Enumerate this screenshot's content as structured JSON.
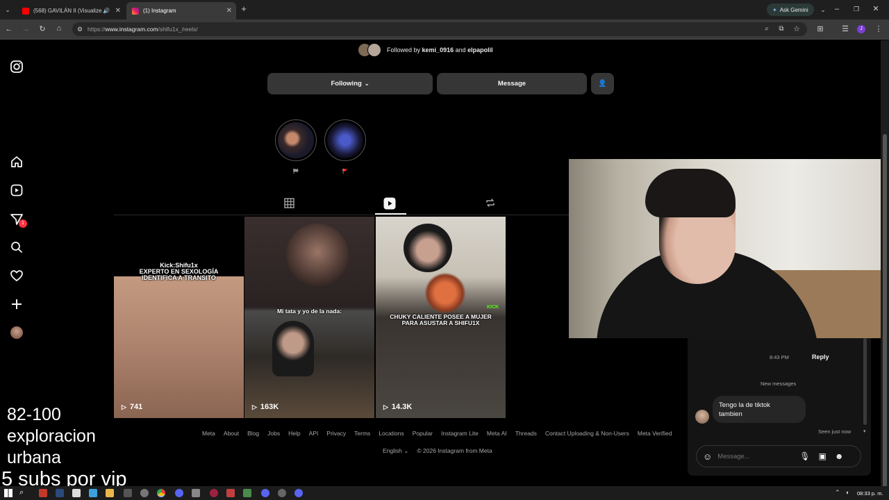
{
  "browser": {
    "tabs": [
      {
        "label": "(568) GAVILÁN II (Visualize",
        "favicon": "youtube"
      },
      {
        "label": "(1) Instagram",
        "favicon": "instagram"
      }
    ],
    "new_tab": "+",
    "url_scheme": "https://",
    "url_host": "www.instagram.com",
    "url_path": "/shifu1x_/reels/",
    "ask_gemini": "Ask Gemini",
    "profile_initial": "J",
    "window_controls": [
      "–",
      "❐",
      "✕"
    ]
  },
  "profile": {
    "followed_by_prefix": "Followed by",
    "followed_by_1": "kemi_0916",
    "followed_by_and": "and",
    "followed_by_2": "elpapolil",
    "following_label": "Following",
    "message_label": "Message",
    "highlights": [
      {
        "label": "🏁"
      },
      {
        "label": "🚩"
      }
    ]
  },
  "nav": {
    "notifications_badge": "1"
  },
  "reels": [
    {
      "views": "741",
      "caption": "Kick:Shifu1x\nEXPERTO EN SEXOLOGÍA\nIDENTIFICA A TRANSITO"
    },
    {
      "views": "163K",
      "caption": "Mi tata y yo de la nada:"
    },
    {
      "views": "14.3K",
      "caption": "CHUKY CALIENTE POSEE A MUJER\nPARA ASUSTAR A SHIFU1X",
      "tag": "KICK"
    }
  ],
  "footer": {
    "links": [
      "Meta",
      "About",
      "Blog",
      "Jobs",
      "Help",
      "API",
      "Privacy",
      "Terms",
      "Locations",
      "Popular",
      "Instagram Lite",
      "Meta AI",
      "Threads",
      "Contact Uploading & Non-Users",
      "Meta Verified"
    ],
    "language": "English",
    "copyright": "© 2026 Instagram from Meta"
  },
  "chat": {
    "time": "8:43 PM",
    "reply_label": "Reply",
    "new_messages": "New messages",
    "message_line1": "Tengo la de tiktok",
    "message_line2": "tambien",
    "seen": "Seen just now",
    "placeholder": "Message..."
  },
  "overlay": {
    "line1": "82-100",
    "line2": "exploracion",
    "line3": "urbana",
    "line4": "5 subs por vip"
  },
  "taskbar": {
    "time": "08:33 p. m."
  },
  "colors": {
    "ig_background": "#000000",
    "button": "#363636",
    "badge": "#ff3040",
    "gemini_accent": "#2b3a37"
  }
}
